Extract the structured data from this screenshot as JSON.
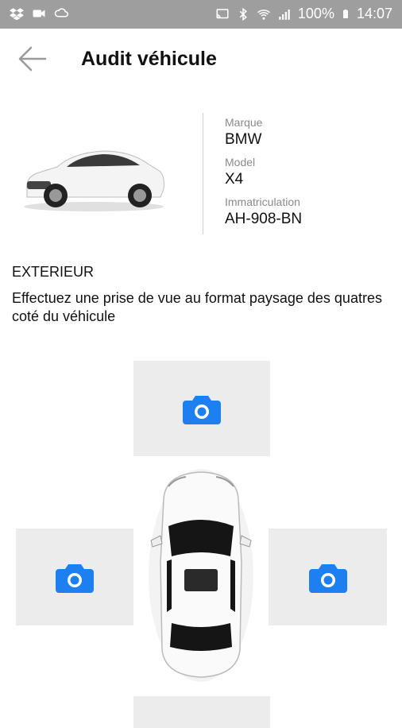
{
  "status_bar": {
    "battery": "100%",
    "time": "14:07",
    "left_icons": [
      "dropbox-icon",
      "video-icon",
      "cloud-sync-icon"
    ],
    "right_icons": [
      "cast-icon",
      "bluetooth-icon",
      "wifi-icon",
      "signal-icon",
      "battery-icon"
    ]
  },
  "header": {
    "title": "Audit véhicule",
    "back_icon": "arrow-left-icon"
  },
  "vehicle": {
    "brand_label": "Marque",
    "brand": "BMW",
    "model_label": "Model",
    "model": "X4",
    "plate_label": "Immatriculation",
    "plate": "AH-908-BN"
  },
  "section": {
    "title": "EXTERIEUR",
    "description": "Effectuez une prise de vue au format paysage des quatres coté du véhicule"
  },
  "photo_slots": [
    {
      "position": "front",
      "icon": "camera-icon"
    },
    {
      "position": "left",
      "icon": "camera-icon"
    },
    {
      "position": "right",
      "icon": "camera-icon"
    },
    {
      "position": "back",
      "icon": "camera-icon"
    }
  ],
  "colors": {
    "status_bar": "#9e9e9e",
    "accent": "#1e7ff0",
    "slot_bg": "#ececec"
  }
}
